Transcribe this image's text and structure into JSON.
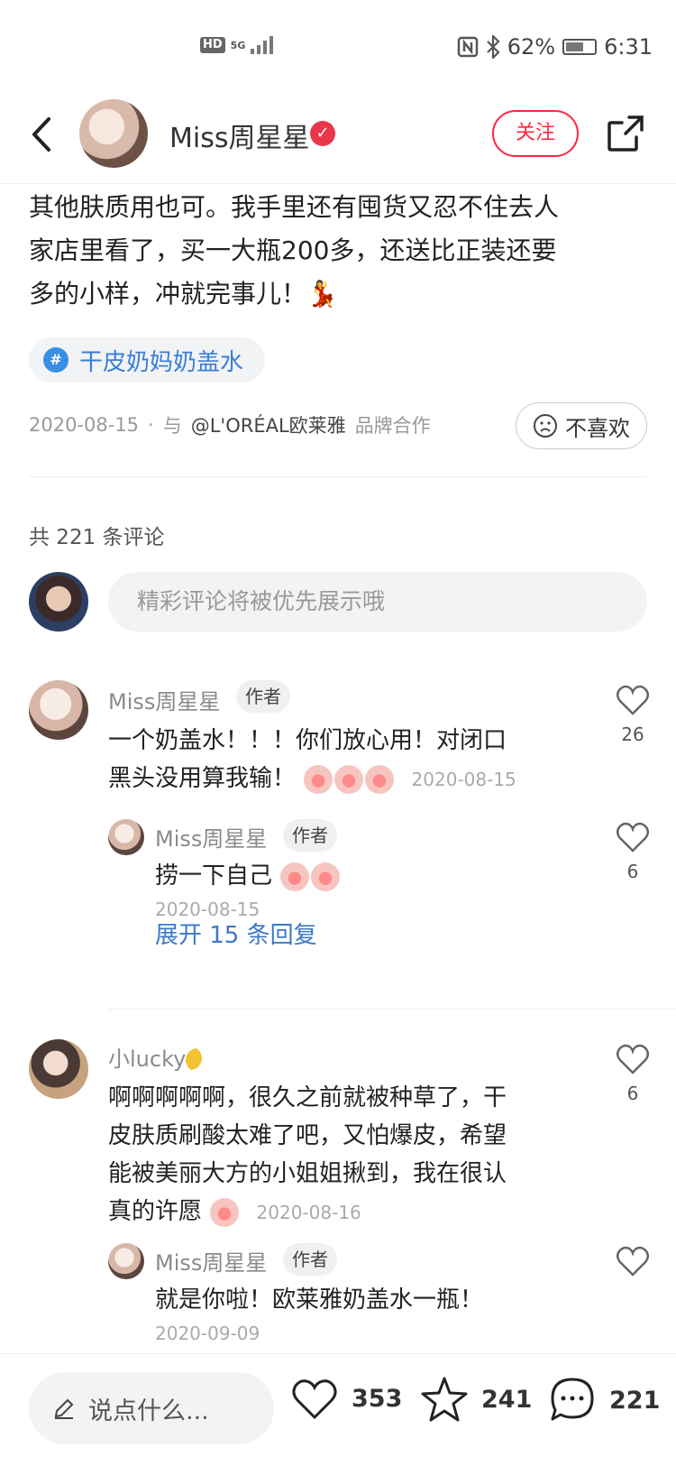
{
  "status_bar": {
    "hd": "HD",
    "net": "5G",
    "battery_text": "62%",
    "battery_level": 0.62,
    "time": "6:31"
  },
  "header": {
    "author_name": "Miss周星星",
    "follow_label": "关注"
  },
  "post": {
    "lines": [
      "其他肤质用也可。我手里还有囤货又忍不住去人",
      "家店里看了，买一大瓶200多，还送比正装还要",
      "多的小样，冲就完事儿！💃"
    ],
    "topic": "干皮奶妈奶盖水",
    "date": "2020-08-15",
    "dot": "·",
    "with": "与",
    "brand": "@L'ORÉAL欧莱雅",
    "cooperation": "品牌合作",
    "dislike_label": "不喜欢"
  },
  "comments_section": {
    "count_label": "共 221 条评论",
    "input_placeholder": "精彩评论将被优先展示哦",
    "expand_label": "展开 15 条回复"
  },
  "comments": [
    {
      "name": "Miss周星星",
      "tag": "作者",
      "text1": "一个奶盖水！！！你们放心用！对闭口",
      "text2": "黑头没用算我输！",
      "date": "2020-08-15",
      "likes": "26"
    },
    {
      "name": "Miss周星星",
      "tag": "作者",
      "text": "捞一下自己",
      "date": "2020-08-15",
      "likes": "6"
    },
    {
      "name": "小lucky",
      "text1": "啊啊啊啊啊，很久之前就被种草了，干",
      "text2": "皮肤质刷酸太难了吧，又怕爆皮，希望",
      "text3": "能被美丽大方的小姐姐揪到，我在很认",
      "text4": "真的许愿",
      "date": "2020-08-16",
      "likes": "6"
    },
    {
      "name": "Miss周星星",
      "tag": "作者",
      "text": "就是你啦！欧莱雅奶盖水一瓶！",
      "date": "2020-09-09"
    }
  ],
  "bottom_bar": {
    "say_placeholder": "说点什么...",
    "likes": "353",
    "collects": "241",
    "comments": "221"
  },
  "icons": {
    "back": "back-arrow-icon",
    "share": "share-icon",
    "topic": "hashtag-icon",
    "like": "heart-icon",
    "collect": "star-icon",
    "comment": "comment-bubble-icon",
    "edit": "pencil-icon"
  }
}
